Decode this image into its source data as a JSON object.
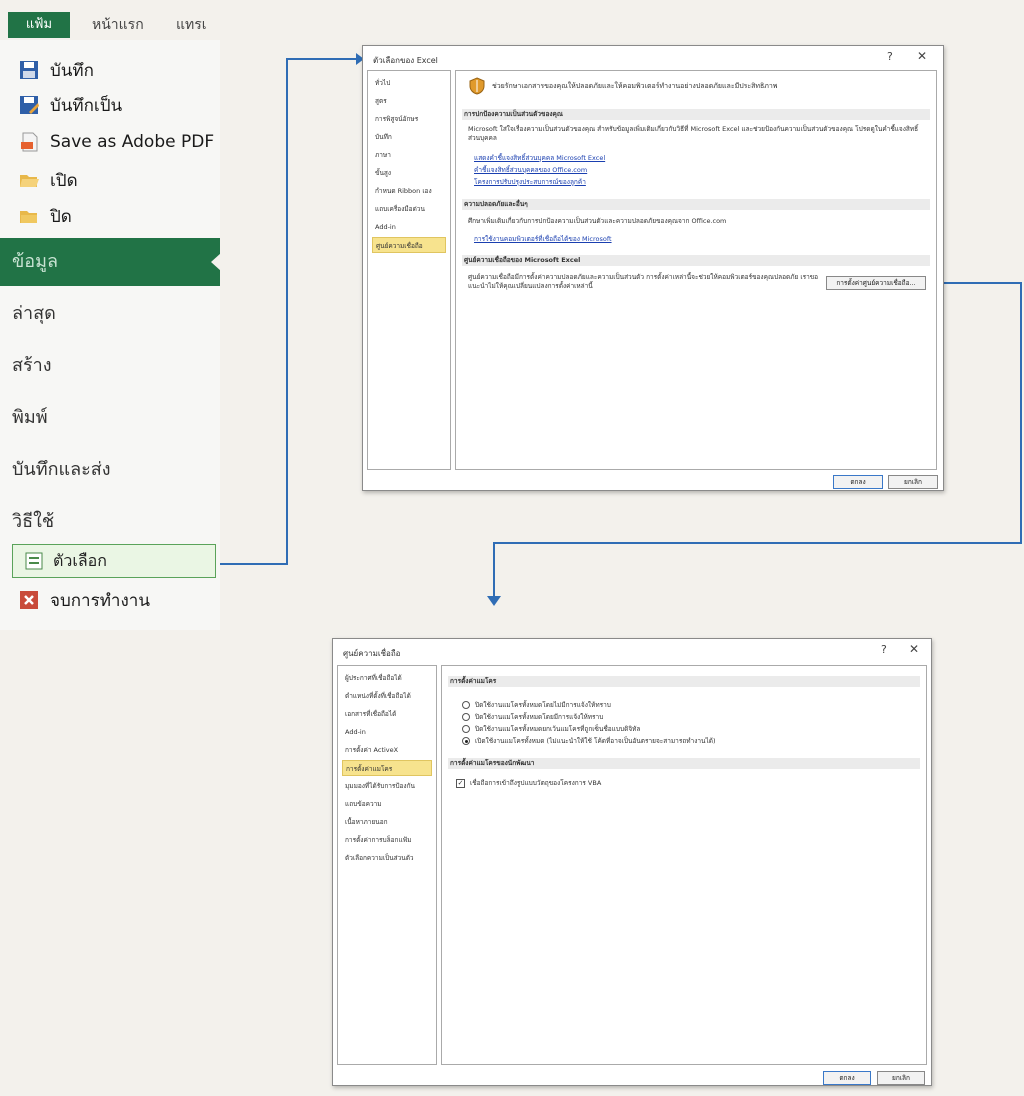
{
  "ribbon": {
    "tabs": [
      "แฟ้ม",
      "หน้าแรก",
      "แทรเ"
    ]
  },
  "backstage": {
    "commands": [
      {
        "label": "บันทึก",
        "icon": "save-icon"
      },
      {
        "label": "บันทึกเป็น",
        "icon": "save-as-icon"
      },
      {
        "label": "Save as Adobe PDF",
        "icon": "pdf-icon"
      },
      {
        "label": "เปิด",
        "icon": "open-folder-icon"
      },
      {
        "label": "ปิด",
        "icon": "close-folder-icon"
      }
    ],
    "sections": [
      "ข้อมูล",
      "ล่าสุด",
      "สร้าง",
      "พิมพ์",
      "บันทึกและส่ง",
      "วิธีใช้"
    ],
    "options_label": "ตัวเลือก",
    "exit_label": "จบการทำงาน"
  },
  "excel_options": {
    "title": "ตัวเลือกของ Excel",
    "help": "?",
    "close": "✕",
    "nav": [
      "ทั่วไป",
      "สูตร",
      "การพิสูจน์อักษร",
      "บันทึก",
      "ภาษา",
      "ขั้นสูง",
      "กำหนด Ribbon เอง",
      "แถบเครื่องมือด่วน",
      "Add-in",
      "ศูนย์ความเชื่อถือ"
    ],
    "banner": "ช่วยรักษาเอกสารของคุณให้ปลอดภัยและให้คอมพิวเตอร์ทำงานอย่างปลอดภัยและมีประสิทธิภาพ",
    "privacy_head": "การปกป้องความเป็นส่วนตัวของคุณ",
    "privacy_text": "Microsoft ใส่ใจเรื่องความเป็นส่วนตัวของคุณ สำหรับข้อมูลเพิ่มเติมเกี่ยวกับวิธีที่ Microsoft Excel และช่วยป้องกันความเป็นส่วนตัวของคุณ โปรดดูในคำชี้แจงสิทธิ์ส่วนบุคคล",
    "privacy_links": [
      "แสดงคำชี้แจงสิทธิ์ส่วนบุคคล Microsoft Excel",
      "คำชี้แจงสิทธิ์ส่วนบุคคลของ Office.com",
      "โครงการปรับปรุงประสบการณ์ของลูกค้า"
    ],
    "security_head": "ความปลอดภัยและอื่นๆ",
    "security_text": "ศึกษาเพิ่มเติมเกี่ยวกับการปกป้องความเป็นส่วนตัวและความปลอดภัยของคุณจาก Office.com",
    "security_link": "การใช้งานคอมพิวเตอร์ที่เชื่อถือได้ของ Microsoft",
    "trust_head": "ศูนย์ความเชื่อถือของ Microsoft Excel",
    "trust_text": "ศูนย์ความเชื่อถือมีการตั้งค่าความปลอดภัยและความเป็นส่วนตัว การตั้งค่าเหล่านี้จะช่วยให้คอมพิวเตอร์ของคุณปลอดภัย เราขอแนะนำไม่ให้คุณเปลี่ยนแปลงการตั้งค่าเหล่านี้",
    "trust_button": "การตั้งค่าศูนย์ความเชื่อถือ...",
    "ok": "ตกลง",
    "cancel": "ยกเลิก"
  },
  "trust_center": {
    "title": "ศูนย์ความเชื่อถือ",
    "help": "?",
    "close": "✕",
    "nav": [
      "ผู้ประกาศที่เชื่อถือได้",
      "ตำแหน่งที่ตั้งที่เชื่อถือได้",
      "เอกสารที่เชื่อถือได้",
      "Add-in",
      "การตั้งค่า ActiveX",
      "การตั้งค่าแมโคร",
      "มุมมองที่ได้รับการป้องกัน",
      "แถบข้อความ",
      "เนื้อหาภายนอก",
      "การตั้งค่าการบล็อกแฟ้ม",
      "ตัวเลือกความเป็นส่วนตัว"
    ],
    "macro_head": "การตั้งค่าแมโคร",
    "radios": [
      "ปิดใช้งานแมโครทั้งหมดโดยไม่มีการแจ้งให้ทราบ",
      "ปิดใช้งานแมโครทั้งหมดโดยมีการแจ้งให้ทราบ",
      "ปิดใช้งานแมโครทั้งหมดยกเว้นแมโครที่ถูกเซ็นชื่อแบบดิจิทัล",
      "เปิดใช้งานแมโครทั้งหมด (ไม่แนะนำให้ใช้ โค้ดที่อาจเป็นอันตรายจะสามารถทำงานได้)"
    ],
    "dev_head": "การตั้งค่าแมโครของนักพัฒนา",
    "vba_check": "เชื่อถือการเข้าถึงรูปแบบวัตถุของโครงการ VBA",
    "ok": "ตกลง",
    "cancel": "ยกเลิก"
  }
}
